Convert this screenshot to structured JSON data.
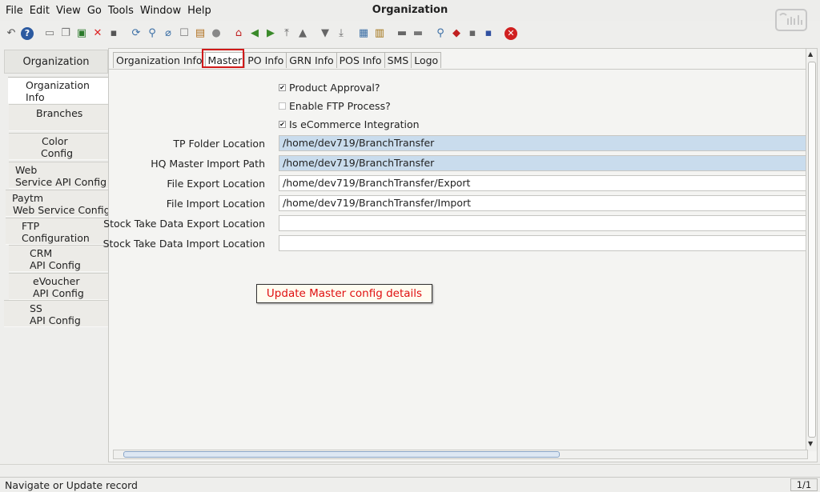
{
  "window": {
    "title": "Organization"
  },
  "menu": [
    "File",
    "Edit",
    "View",
    "Go",
    "Tools",
    "Window",
    "Help"
  ],
  "toolbar": {
    "icons": [
      "undo-icon",
      "help-icon",
      "new-icon",
      "copy-icon",
      "save-green-icon",
      "delete-icon",
      "save-icon",
      "refresh-icon",
      "find-icon",
      "attach-icon",
      "chat-icon",
      "history-icon",
      "menu-icon",
      "home-icon",
      "back-icon",
      "forward-icon",
      "first-record-icon",
      "previous-record-icon",
      "next-record-icon",
      "last-record-icon",
      "report-icon",
      "archive-icon",
      "print-preview-icon",
      "print-icon",
      "zoom-icon",
      "workflow-icon",
      "request-icon",
      "product-icon",
      "close-icon"
    ]
  },
  "sidebar": {
    "header": "Organization",
    "items": [
      {
        "lines": [
          "Organization",
          "Info"
        ],
        "active": true
      },
      {
        "lines": [
          "Branches"
        ],
        "active": false
      },
      {
        "lines": [
          "Color",
          "Config"
        ],
        "active": false
      },
      {
        "lines": [
          "Web",
          "Service API Config"
        ],
        "active": false
      },
      {
        "lines": [
          "Paytm",
          "Web Service Config"
        ],
        "active": false
      },
      {
        "lines": [
          "FTP",
          "Configuration"
        ],
        "active": false
      },
      {
        "lines": [
          "CRM",
          "API Config"
        ],
        "active": false
      },
      {
        "lines": [
          "eVoucher",
          "API Config"
        ],
        "active": false
      },
      {
        "lines": [
          "SS",
          "API Config"
        ],
        "active": false
      }
    ]
  },
  "tabs": [
    {
      "label": "Organization Info",
      "active": false
    },
    {
      "label": "Master",
      "active": true
    },
    {
      "label": "PO Info",
      "active": false
    },
    {
      "label": "GRN Info",
      "active": false
    },
    {
      "label": "POS Info",
      "active": false
    },
    {
      "label": "SMS",
      "active": false
    },
    {
      "label": "Logo",
      "active": false
    }
  ],
  "checkboxes": [
    {
      "label": "Product Approval?",
      "checked": true
    },
    {
      "label": "Enable FTP Process?",
      "checked": false
    },
    {
      "label": "Is eCommerce Integration",
      "checked": true
    }
  ],
  "fields": [
    {
      "label": "TP Folder Location",
      "value": "/home/dev719/BranchTransfer",
      "highlight": true
    },
    {
      "label": "HQ Master Import Path",
      "value": "/home/dev719/BranchTransfer",
      "highlight": true
    },
    {
      "label": "File Export Location",
      "value": "/home/dev719/BranchTransfer/Export",
      "highlight": false
    },
    {
      "label": "File Import Location",
      "value": "/home/dev719/BranchTransfer/Import",
      "highlight": false
    },
    {
      "label": "Stock Take Data Export Location",
      "value": "",
      "highlight": false
    },
    {
      "label": "Stock Take Data Import Location",
      "value": "",
      "highlight": false
    }
  ],
  "annotation": "Update Master config details",
  "status": {
    "message": "Navigate or Update record",
    "record_count": "1/1"
  },
  "colors": {
    "highlight_red": "#d11a1a",
    "field_blue": "#c9dced",
    "annotation_text": "#e01010"
  }
}
